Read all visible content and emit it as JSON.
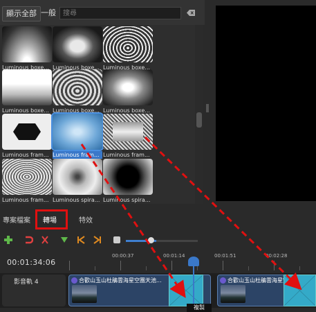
{
  "filter_bar": {
    "show_all_label": "顯示全部",
    "general_label": "一般",
    "search_placeholder": "搜尋"
  },
  "transitions": [
    {
      "label": "Luminous boxe..."
    },
    {
      "label": "Luminous boxe..."
    },
    {
      "label": "Luminous boxe..."
    },
    {
      "label": "Luminous boxe..."
    },
    {
      "label": "Luminous boxe..."
    },
    {
      "label": "Luminous boxe..."
    },
    {
      "label": "Luminous fram..."
    },
    {
      "label": "Luminous fram...",
      "selected": true
    },
    {
      "label": "Luminous fram..."
    },
    {
      "label": "Luminous fram..."
    },
    {
      "label": "Luminous spira..."
    },
    {
      "label": "Luminous spira..."
    }
  ],
  "tabs": {
    "files_label": "專案檔案",
    "transitions_label": "轉場",
    "effects_label": "特效"
  },
  "timeline": {
    "timecode": "00:01:34:06",
    "ruler_labels": [
      "00:00:37",
      "00:01:14",
      "00:01:51",
      "00:02:28"
    ],
    "track_name": "影音軌 4",
    "clips": [
      {
        "title": "合歡山玉山杜鵑雲海星空團天池..."
      },
      {
        "title": "合歡山玉山杜鵑雲海星空團天池..."
      }
    ],
    "tooltip": "複製"
  },
  "colors": {
    "highlight": "#e01010",
    "accent": "#3a78c9",
    "arrow": "#e01010"
  }
}
